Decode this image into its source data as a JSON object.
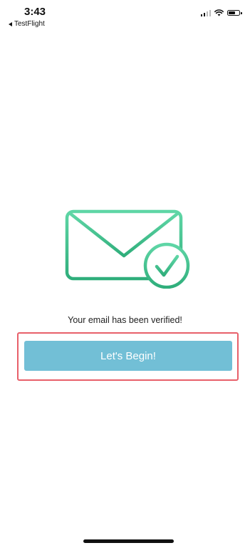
{
  "status_bar": {
    "time": "3:43",
    "back_label": "TestFlight",
    "icons": [
      "signal-icon",
      "wifi-icon",
      "battery-icon"
    ],
    "battery_level": 0.7
  },
  "illustration": {
    "icon": "envelope-check-icon",
    "color": "#3fc08f"
  },
  "message": "Your email has been verified!",
  "primary_button": {
    "label": "Let's Begin!",
    "color": "#72bfd6"
  },
  "highlight_color": "#e8606a"
}
